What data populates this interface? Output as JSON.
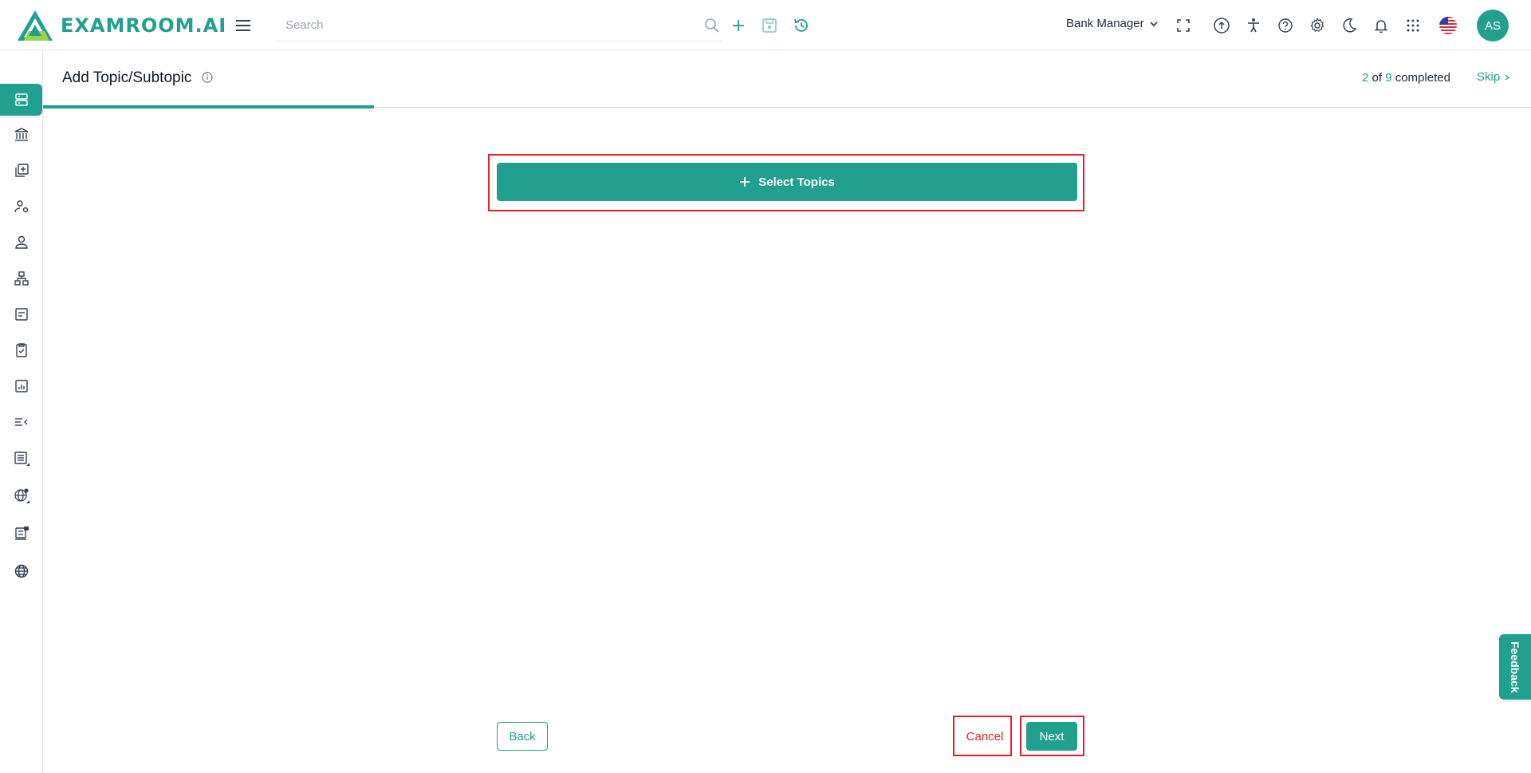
{
  "app": {
    "logo_text": "EXAMROOM.AI"
  },
  "search": {
    "placeholder": "Search"
  },
  "header": {
    "role": "Bank Manager",
    "avatar_initials": "AS"
  },
  "step": {
    "title": "Add Topic/Subtopic",
    "completed_count": "2",
    "of_text": "of",
    "total": "9",
    "completed_text": "completed",
    "skip_label": "Skip",
    "progress_fraction": 0.222
  },
  "main": {
    "select_topics_label": "Select Topics",
    "back_label": "Back",
    "cancel_label": "Cancel",
    "next_label": "Next"
  },
  "feedback_label": "Feedback",
  "colors": {
    "accent": "#22a08f",
    "danger": "#e3212b"
  },
  "icons": {
    "topbar": [
      "search-icon",
      "plus-icon",
      "save-icon",
      "history-icon",
      "fullscreen-icon",
      "upload-icon",
      "accessibility-icon",
      "help-icon",
      "settings-icon",
      "dark-mode-icon",
      "notification-icon",
      "apps-grid-icon",
      "us-flag-icon"
    ],
    "sidebar": [
      "server-icon",
      "bank-icon",
      "add-library-icon",
      "user-settings-icon",
      "user-icon",
      "hierarchy-icon",
      "form-icon",
      "clipboard-check-icon",
      "report-chart-icon",
      "collapse-list-icon",
      "list-doc-icon",
      "globe-settings-icon",
      "machine-icon",
      "globe-icon"
    ]
  }
}
